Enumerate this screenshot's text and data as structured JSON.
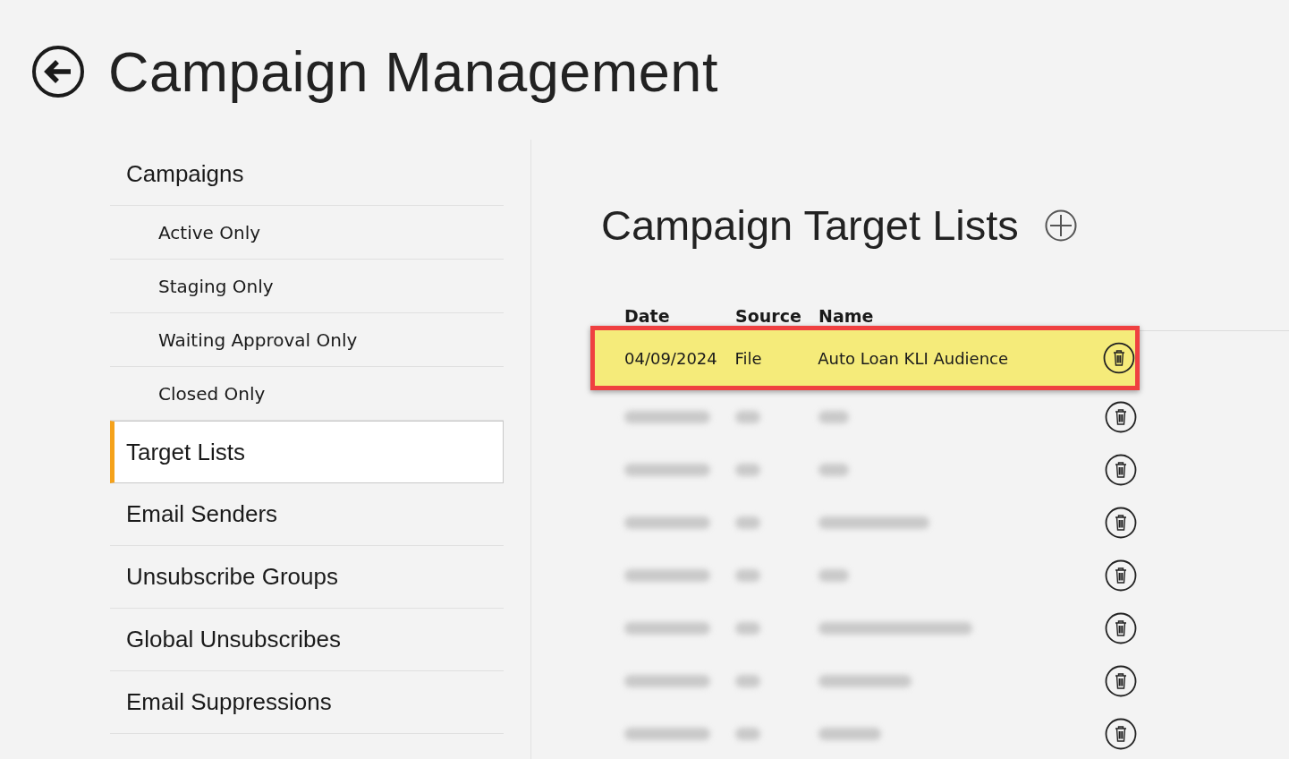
{
  "header": {
    "title": "Campaign Management"
  },
  "sidebar": {
    "items": [
      {
        "label": "Campaigns",
        "kind": "section",
        "selected": false
      },
      {
        "label": "Active Only",
        "kind": "filter",
        "selected": false
      },
      {
        "label": "Staging Only",
        "kind": "filter",
        "selected": false
      },
      {
        "label": "Waiting Approval Only",
        "kind": "filter",
        "selected": false
      },
      {
        "label": "Closed Only",
        "kind": "filter",
        "selected": false
      },
      {
        "label": "Target Lists",
        "kind": "section",
        "selected": true
      },
      {
        "label": "Email Senders",
        "kind": "section",
        "selected": false
      },
      {
        "label": "Unsubscribe Groups",
        "kind": "section",
        "selected": false
      },
      {
        "label": "Global Unsubscribes",
        "kind": "section",
        "selected": false
      },
      {
        "label": "Email Suppressions",
        "kind": "section",
        "selected": false
      }
    ]
  },
  "content": {
    "title": "Campaign Target Lists",
    "table": {
      "columns": [
        "Date",
        "Source",
        "Name"
      ],
      "rows": [
        {
          "date": "04/09/2024",
          "source": "File",
          "name": "Auto Loan KLI Audience",
          "highlighted": true,
          "blurred": false
        },
        {
          "highlighted": false,
          "blurred": true
        },
        {
          "highlighted": false,
          "blurred": true
        },
        {
          "highlighted": false,
          "blurred": true
        },
        {
          "highlighted": false,
          "blurred": true
        },
        {
          "highlighted": false,
          "blurred": true
        },
        {
          "highlighted": false,
          "blurred": true
        },
        {
          "highlighted": false,
          "blurred": true
        }
      ]
    }
  }
}
